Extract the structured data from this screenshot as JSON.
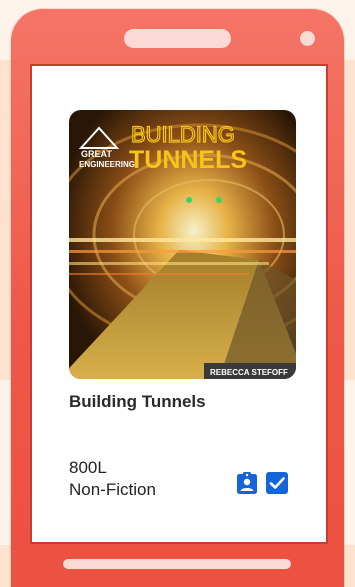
{
  "book": {
    "title": "Building Tunnels",
    "lexile": "800L",
    "genre": "Non-Fiction"
  },
  "cover": {
    "series_line1": "GREAT",
    "series_line2": "ENGINEERING",
    "title_line1": "BUILDING",
    "title_line2": "TUNNELS",
    "author": "REBECCA STEFOFF"
  },
  "icons": {
    "assignment": "clipboard-person-icon",
    "done": "checkbox-checked-icon"
  },
  "colors": {
    "phone": "#ee5848",
    "phone_light": "#fbd9d4",
    "icon_blue": "#1565d8",
    "cover_title_yellow": "#f7c417"
  }
}
